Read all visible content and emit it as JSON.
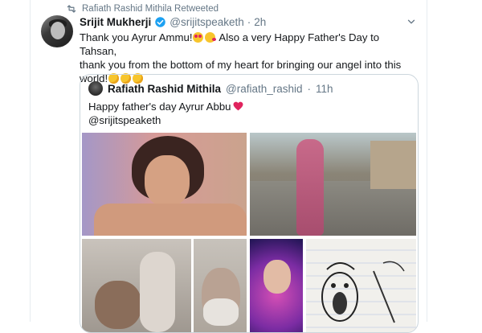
{
  "retweet": {
    "text": "Rafiath Rashid Mithila Retweeted",
    "icon": "retweet-icon"
  },
  "tweet": {
    "author_name": "Srijit Mukherji",
    "handle": "@srijitspeaketh",
    "time": "2h",
    "line1": "Thank you Ayrur Ammu!",
    "line1_after": " Also a very Happy Father's Day to Tahsan,",
    "line2": "thank you from the bottom of my heart for bringing our angel into this",
    "line3": "world!",
    "emojis": [
      "smiling-face-heart-eyes",
      "face-blowing-kiss",
      "hugging-face",
      "hugging-face",
      "hugging-face"
    ]
  },
  "quote": {
    "author_name": "Rafiath Rashid Mithila",
    "handle": "@rafiath_rashid",
    "time": "11h",
    "text_line1": "Happy father's day Ayrur Abbu",
    "text_line2": "@srijitspeaketh",
    "photos": [
      "girl-portrait-photo",
      "rooftop-photo",
      "father-daughter-photo",
      "bearded-man-selfie-photo",
      "girl-sparkle-filter-photo",
      "cartoon-sketch-photo"
    ]
  },
  "colors": {
    "text": "#14171a",
    "secondary": "#657786",
    "accent": "#1da1f2",
    "border": "#ccd6dd",
    "heart": "#e0245e"
  }
}
